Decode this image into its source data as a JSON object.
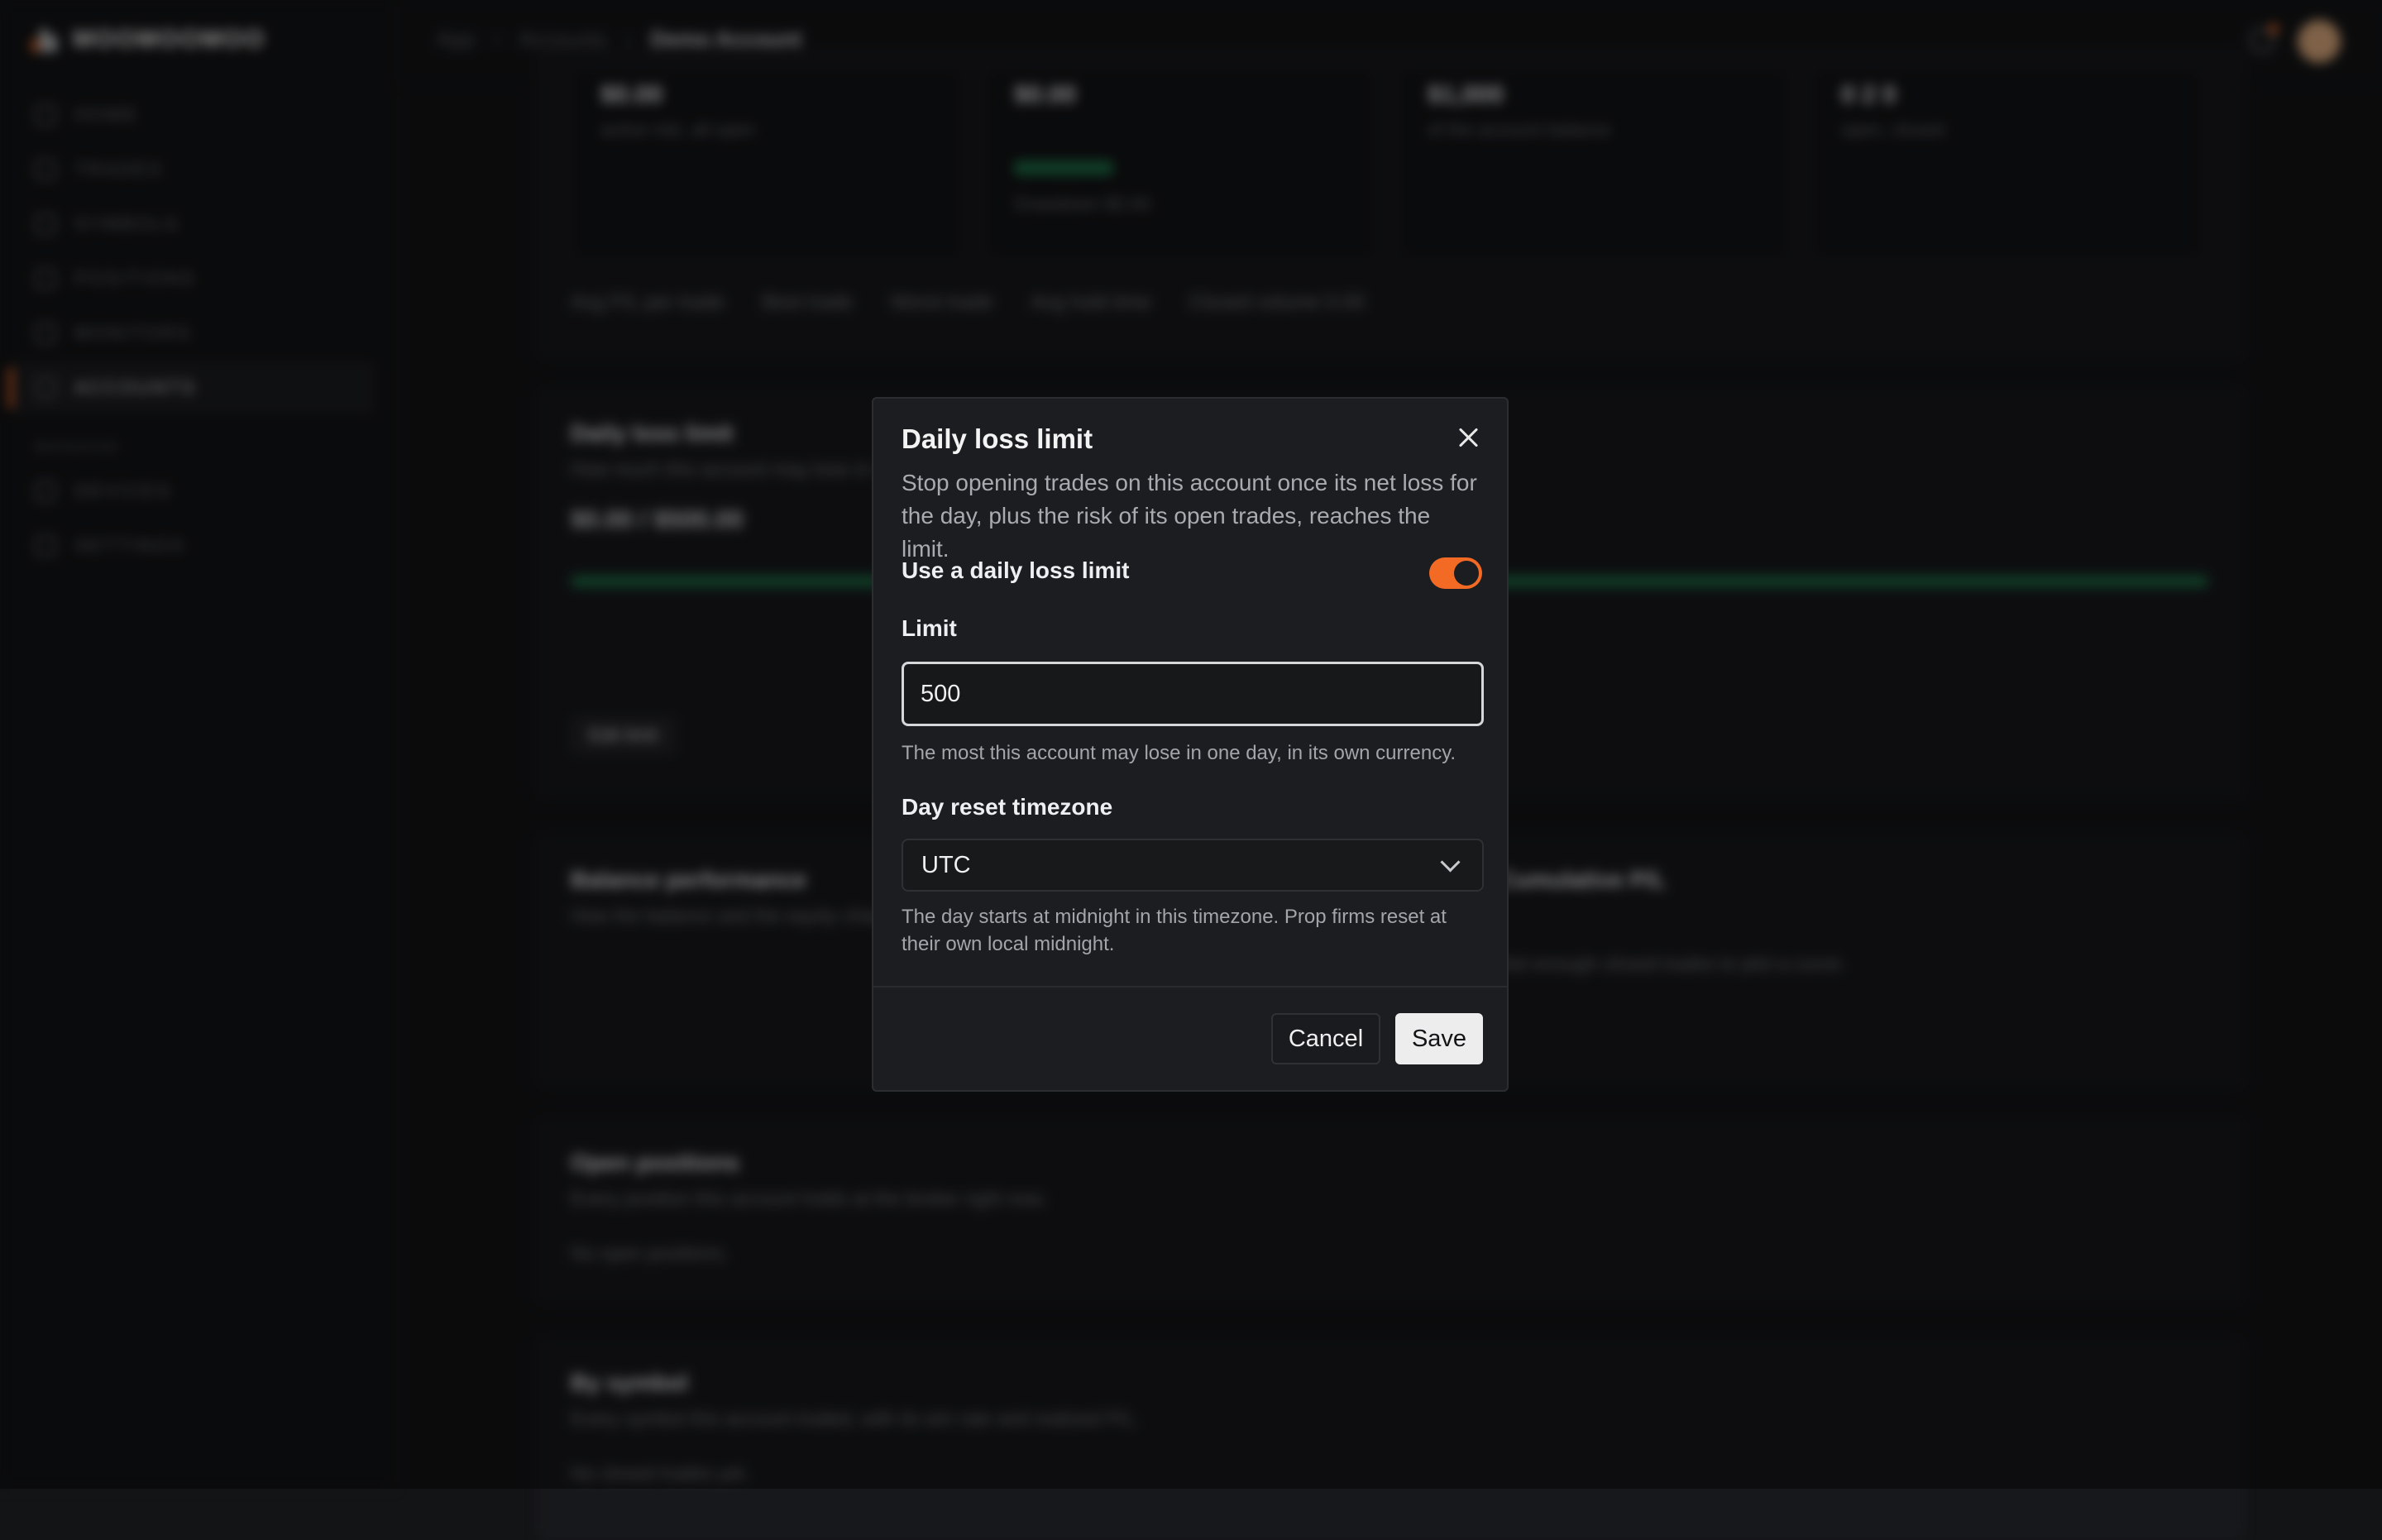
{
  "app": {
    "brand_name": "MOOMOOMOO",
    "nav": [
      {
        "label": "HOME",
        "icon": "home-icon"
      },
      {
        "label": "TRADES",
        "icon": "trades-icon"
      },
      {
        "label": "SYMBOLS",
        "icon": "symbols-icon"
      },
      {
        "label": "POSITIONS",
        "icon": "positions-icon"
      },
      {
        "label": "MONITORS",
        "icon": "monitors-icon"
      },
      {
        "label": "ACCOUNTS",
        "icon": "accounts-icon",
        "active": true
      }
    ],
    "nav_section_label": "MANAGE",
    "nav_secondary": [
      {
        "label": "DEVICES",
        "icon": "devices-icon"
      },
      {
        "label": "SETTINGS",
        "icon": "settings-icon"
      }
    ]
  },
  "breadcrumb": [
    "App",
    "Accounts",
    "Demo Account"
  ],
  "background": {
    "stats": [
      {
        "value": "$0.00",
        "sub": "active risk, all open"
      },
      {
        "value": "$0.00",
        "sub": "Drawdown $0.00"
      },
      {
        "value": "$1,000",
        "sub": "of the account balance"
      },
      {
        "value": "0  2  0",
        "sub": "open, closed"
      }
    ],
    "chips": [
      "Avg P/L per trade",
      "Best trade",
      "Worst trade",
      "Avg hold time",
      "Closed volume  0.00"
    ],
    "daily_loss": {
      "title": "Daily loss limit",
      "sub": "How much this account may lose in a day",
      "range": "$0.00 / $500.00",
      "edit_label": "Edit limit"
    },
    "balance": {
      "title": "Balance performance",
      "sub": "How the balance and the equity changed"
    },
    "cumulative": {
      "title": "Cumulative P/L",
      "sub": "Not enough closed trades to plot a curve."
    },
    "open_positions": {
      "title": "Open positions",
      "sub": "Every position this account holds at the broker right now.",
      "empty": "No open positions."
    },
    "by_symbol": {
      "title": "By symbol",
      "sub": "Every symbol this account traded, with its win rate and realized P/L.",
      "empty": "No closed trades yet."
    }
  },
  "modal": {
    "title": "Daily loss limit",
    "description": "Stop opening trades on this account once its net loss for the day, plus the risk of its open trades, reaches the limit.",
    "toggle_label": "Use a daily loss limit",
    "toggle_on": true,
    "accent_color": "#f26a24",
    "limit_label": "Limit",
    "limit_value": "500",
    "limit_hint": "The most this account may lose in one day, in its own currency.",
    "timezone_label": "Day reset timezone",
    "timezone_value": "UTC",
    "timezone_hint": "The day starts at midnight in this timezone. Prop firms reset at their own local midnight.",
    "cancel_label": "Cancel",
    "save_label": "Save"
  }
}
